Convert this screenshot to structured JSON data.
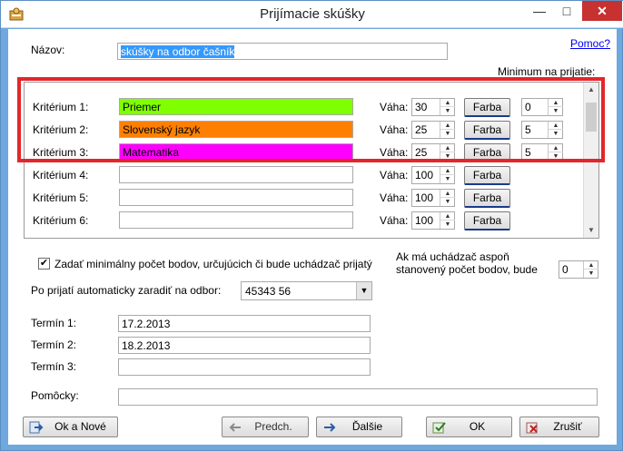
{
  "window": {
    "title": "Prijímacie skúšky"
  },
  "name": {
    "label": "Názov:",
    "value": "skúšky na odbor čašník"
  },
  "help_link": "Pomoc?",
  "minimum_header": "Minimum na prijatie:",
  "criteria": [
    {
      "label": "Kritérium 1:",
      "value": "Priemer",
      "color": "#80ff00",
      "weight_label": "Váha:",
      "weight": "30",
      "color_button": "Farba",
      "minimum": "0"
    },
    {
      "label": "Kritérium 2:",
      "value": "Slovenský jazyk",
      "color": "#ff8000",
      "weight_label": "Váha:",
      "weight": "25",
      "color_button": "Farba",
      "minimum": "5"
    },
    {
      "label": "Kritérium 3:",
      "value": "Matematika",
      "color": "#ff00ff",
      "weight_label": "Váha:",
      "weight": "25",
      "color_button": "Farba",
      "minimum": "5"
    },
    {
      "label": "Kritérium 4:",
      "value": "",
      "color": "#ffffff",
      "weight_label": "Váha:",
      "weight": "100",
      "color_button": "Farba",
      "minimum": ""
    },
    {
      "label": "Kritérium 5:",
      "value": "",
      "color": "#ffffff",
      "weight_label": "Váha:",
      "weight": "100",
      "color_button": "Farba",
      "minimum": ""
    },
    {
      "label": "Kritérium 6:",
      "value": "",
      "color": "#ffffff",
      "weight_label": "Váha:",
      "weight": "100",
      "color_button": "Farba",
      "minimum": ""
    }
  ],
  "min_points": {
    "checkbox_label": "Zadať minimálny počet bodov, určujúcich či bude uchádzač prijatý",
    "checked": true,
    "question": "Ak má uchádzač aspoň stanovený počet bodov, bude prijatý:",
    "value": "0"
  },
  "assign": {
    "label": "Po prijatí automaticky zaradiť na odbor:",
    "value": "45343 56"
  },
  "terms": [
    {
      "label": "Termín 1:",
      "value": "17.2.2013"
    },
    {
      "label": "Termín 2:",
      "value": "18.2.2013"
    },
    {
      "label": "Termín 3:",
      "value": ""
    }
  ],
  "aids": {
    "label": "Pomôcky:",
    "value": ""
  },
  "buttons": {
    "ok_new": "Ok a Nové",
    "prev": "Predch.",
    "next": "Ďalšie",
    "ok": "OK",
    "cancel": "Zrušiť"
  }
}
